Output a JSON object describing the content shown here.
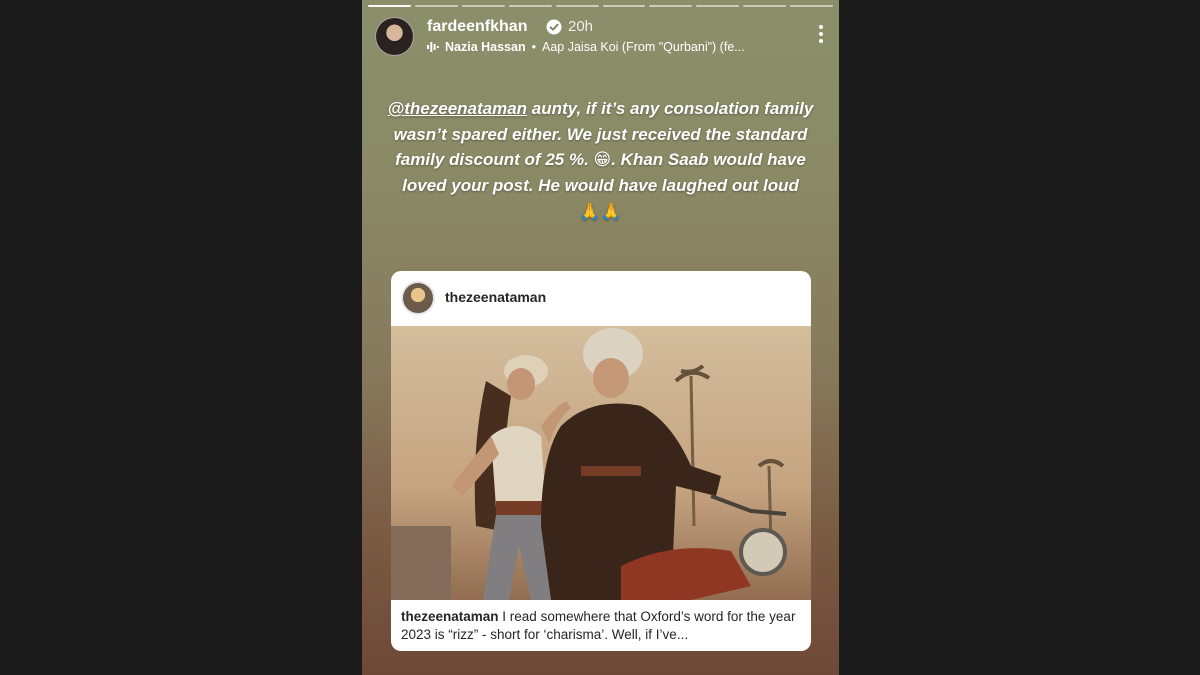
{
  "story": {
    "progress_segments": 10,
    "active_segment": 0,
    "username": "fardeenfkhan",
    "verified": true,
    "time_ago": "20h",
    "music": {
      "icon": "audio-wave-icon",
      "artist": "Nazia Hassan",
      "separator": "•",
      "song": "Aap Jaisa Koi (From \"Qurbani\") (fe..."
    },
    "menu_icon": "more-vertical-icon",
    "caption": {
      "mention": "@thezeenataman",
      "text": " aunty, if it’s any consolation family wasn’t spared either. We just received the standard family discount of 25 %. 😁.  Khan Saab would have loved your post. He would have laughed out loud",
      "emoji_line": "🙏🙏"
    },
    "shared_post": {
      "username": "thezeenataman",
      "caption_user": "thezeenataman",
      "caption_text": " I read somewhere that Oxford’s word for the year 2023 is “rizz” - short for ‘charisma’. Well, if I’ve..."
    }
  },
  "colors": {
    "page_bg": "#1b1b1b",
    "story_top": "#8a8f6a",
    "story_bottom": "#6e4936",
    "verified_blue": "#ffffff"
  }
}
